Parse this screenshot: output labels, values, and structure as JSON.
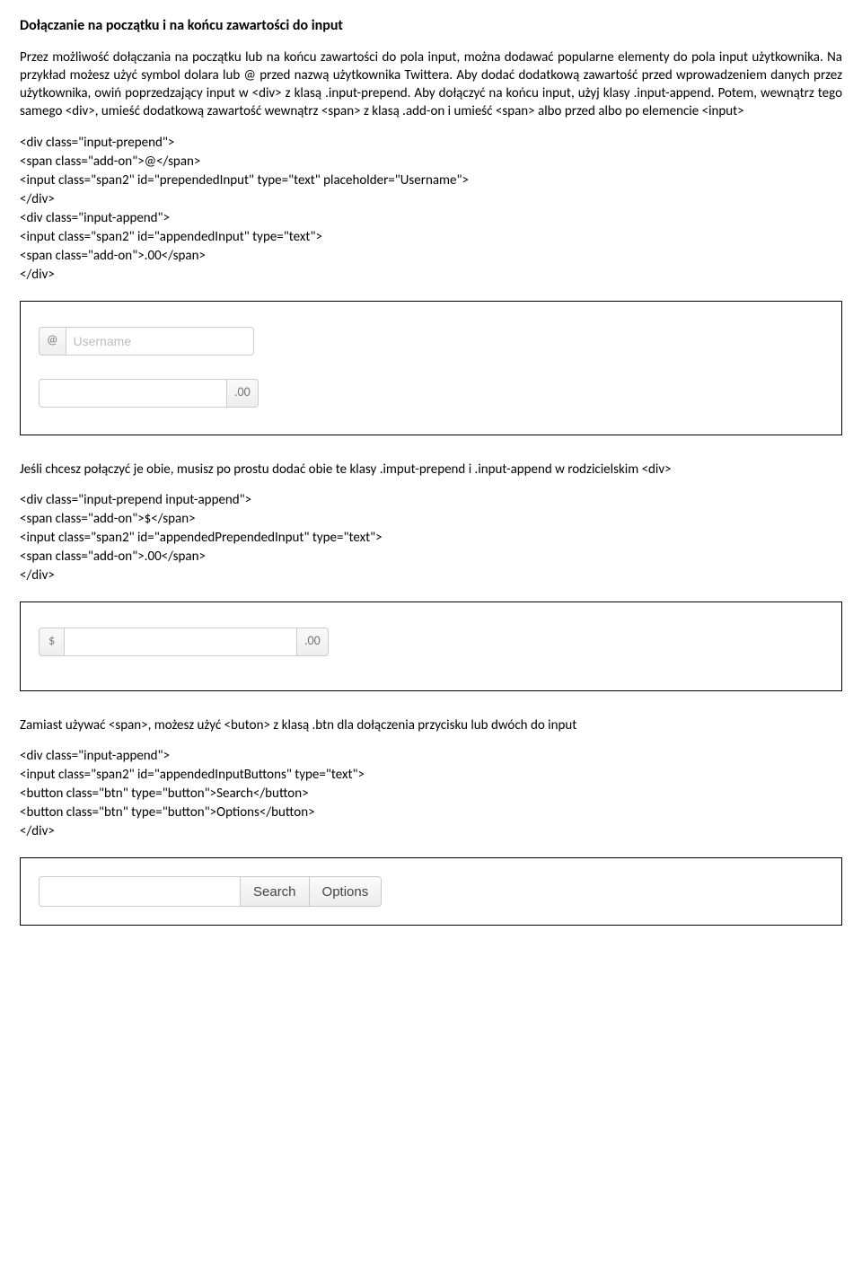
{
  "heading": "Dołączanie na początku i na końcu zawartości do input",
  "para1": "Przez możliwość dołączania na początku lub na końcu zawartości do pola input, można dodawać popularne elementy do pola input użytkownika. Na przykład możesz użyć symbol dolara lub @ przed nazwą użytkownika Twittera. Aby dodać dodatkową zawartość przed wprowadzeniem danych przez użytkownika, owiń poprzedzający input w <div> z klasą .input-prepend. Aby dołączyć na końcu input, użyj klasy .input-append. Potem, wewnątrz tego samego <div>, umieść dodatkową zawartość wewnątrz <span> z klasą .add-on i umieść <span> albo przed albo po elemencie <input>",
  "code1": {
    "l1": "<div class=\"input-prepend\">",
    "l2": "<span class=\"add-on\">@</span>",
    "l3": "<input class=\"span2\" id=\"prependedInput\" type=\"text\" placeholder=\"Username\">",
    "l4": "</div>",
    "l5": "<div class=\"input-append\">",
    "l6": "<input class=\"span2\" id=\"appendedInput\" type=\"text\">",
    "l7": "<span class=\"add-on\">.00</span>",
    "l8": "</div>"
  },
  "figure1": {
    "prependAddon": "@",
    "prependPlaceholder": "Username",
    "appendAddon": ".00"
  },
  "para2": "Jeśli chcesz połączyć je obie, musisz po prostu dodać obie te klasy .imput-prepend i .input-append w rodzicielskim <div>",
  "code2": {
    "l1": "<div class=\"input-prepend input-append\">",
    "l2": "<span class=\"add-on\">$</span>",
    "l3": "<input class=\"span2\" id=\"appendedPrependedInput\" type=\"text\">",
    "l4": "<span class=\"add-on\">.00</span>",
    "l5": "</div>"
  },
  "figure2": {
    "prependAddon": "$",
    "appendAddon": ".00"
  },
  "para3": "Zamiast używać <span>, możesz użyć <buton> z klasą .btn dla dołączenia przycisku lub dwóch do input",
  "code3": {
    "l1": "<div class=\"input-append\">",
    "l2": "<input class=\"span2\" id=\"appendedInputButtons\" type=\"text\">",
    "l3": "<button class=\"btn\" type=\"button\">Search</button>",
    "l4": "<button class=\"btn\" type=\"button\">Options</button>",
    "l5": "</div>"
  },
  "figure3": {
    "btn1": "Search",
    "btn2": "Options"
  }
}
